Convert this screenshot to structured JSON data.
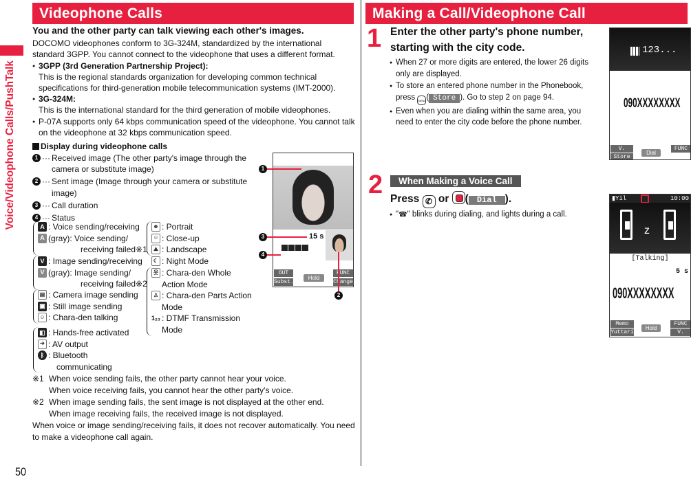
{
  "side_label": "Voice/Videophone Calls/PushTalk",
  "page_number": "50",
  "left": {
    "section_title": "Videophone Calls",
    "lead": "You and the other party can talk viewing each other's images.",
    "intro": "DOCOMO videophones conform to 3G-324M, standardized by the international standard 3GPP. You cannot connect to the videophone that uses a different format.",
    "bullets": [
      {
        "title": "3GPP (3rd Generation Partnership Project):",
        "text": "This is the regional standards organization for developing common technical specifications for third-generation mobile telecommunication systems (IMT-2000)."
      },
      {
        "title": "3G-324M:",
        "text": "This is the international standard for the third generation of mobile videophones."
      },
      {
        "title": "",
        "text": "P-07A supports only 64 kbps communication speed of the videophone. You cannot talk on the videophone at 32 kbps communication speed."
      }
    ],
    "display_heading": "Display during videophone calls",
    "numbered": [
      {
        "n": "1",
        "text": "Received image (The other party's image through the camera or substitute image)"
      },
      {
        "n": "2",
        "text": "Sent image (Image through your camera or substitute image)"
      },
      {
        "n": "3",
        "text": "Call duration"
      },
      {
        "n": "4",
        "text": "Status"
      }
    ],
    "status_groups": {
      "voice": [
        {
          "icon": "A",
          "label": ": Voice sending/receiving"
        },
        {
          "icon": "A",
          "label": "(gray): Voice sending/",
          "cont": "receiving failed※1"
        }
      ],
      "image": [
        {
          "icon": "V",
          "label": ": Image sending/receiving"
        },
        {
          "icon": "V",
          "label": "(gray): Image sending/",
          "cont": "receiving failed※2"
        }
      ],
      "source": [
        {
          "icon": "cam",
          "label": ": Camera image sending"
        },
        {
          "icon": "still",
          "label": ": Still image sending"
        },
        {
          "icon": "chara",
          "label": ": Chara-den talking"
        }
      ],
      "output": [
        {
          "icon": "handsfree",
          "label": ": Hands-free activated"
        },
        {
          "icon": "av",
          "label": ": AV output"
        },
        {
          "icon": "bt",
          "label": ": Bluetooth",
          "cont": "communicating"
        }
      ],
      "camera_mode": [
        {
          "icon": "portrait",
          "label": ": Portrait"
        },
        {
          "icon": "closeup",
          "label": ": Close-up"
        },
        {
          "icon": "landscape",
          "label": ": Landscape"
        }
      ],
      "chara_mode": [
        {
          "icon": "night",
          "label": ": Night Mode"
        },
        {
          "icon": "whole",
          "label": ": Chara-den Whole",
          "cont": "Action Mode"
        },
        {
          "icon": "parts",
          "label": ": Chara-den Parts Action",
          "cont": "Mode"
        },
        {
          "icon": "dtmf",
          "label": ": DTMF Transmission",
          "cont": "Mode"
        }
      ]
    },
    "notes": [
      {
        "mark": "※1",
        "lines": [
          "When voice sending fails, the other party cannot hear your voice.",
          "When voice receiving fails, you cannot hear the other party's voice."
        ]
      },
      {
        "mark": "※2",
        "lines": [
          "When image sending fails, the sent image is not displayed at the other end.",
          "When image receiving fails, the received image is not displayed."
        ]
      }
    ],
    "closing": "When voice or image sending/receiving fails, it does not recover automatically. You need to make a videophone call again.",
    "phone_screen": {
      "duration": "15 s",
      "softkeys": {
        "top_left": "OUT",
        "bottom_left": "Subst.",
        "center": "Hold",
        "top_right": "FUNC",
        "bottom_right": "Change"
      },
      "callouts": [
        "1",
        "3",
        "4",
        "2"
      ]
    }
  },
  "right": {
    "section_title": "Making a Call/Videophone Call",
    "step1": {
      "number": "1",
      "title": "Enter the other party's phone number, starting with the city code.",
      "bullets": [
        "When 27 or more digits are entered, the lower 26 digits only are displayed.",
        "To store an entered phone number in the Phonebook, press",
        "Even when you are dialing within the same area, you need to enter the city code before the phone number."
      ],
      "store_key_label": "MENU",
      "store_soft_label": "Store",
      "store_suffix": "). Go to step 2 on page 94.",
      "screen": {
        "header": "123...",
        "number": "090XXXXXXXX",
        "softkeys": {
          "top_left": "V. phone",
          "bottom_left": "Store",
          "center": "Dial",
          "top_right": "FUNC"
        }
      }
    },
    "step2": {
      "number": "2",
      "banner": "When Making a Voice Call",
      "press": "Press",
      "or": "or",
      "dial_label": "Dial",
      "bullet": "\" blinks during dialing, and lights during a call.",
      "screen": {
        "time": "10:00",
        "status": "[Talking]",
        "duration": "5 s",
        "number": "090XXXXXXXX",
        "softkeys": {
          "top_left": "Memo",
          "bottom_left": "Yuttari",
          "center": "Hold",
          "top_right": "FUNC",
          "bottom_right": "V. phone"
        }
      }
    }
  },
  "colors": {
    "accent": "#e8203f",
    "banner_gray": "#555555"
  }
}
